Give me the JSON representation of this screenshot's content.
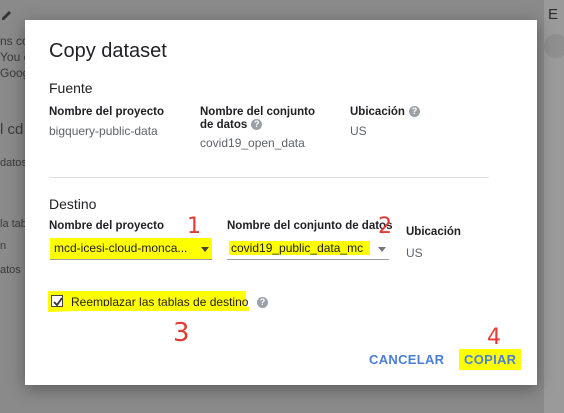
{
  "background": {
    "fragments": [
      "ns co",
      "You c",
      "Goog",
      "l cd",
      "datos",
      "la tab",
      "n",
      "atos"
    ],
    "right_letter": "E"
  },
  "dialog": {
    "title": "Copy dataset",
    "source": {
      "heading": "Fuente",
      "project_label": "Nombre del proyecto",
      "project_value": "bigquery-public-data",
      "dataset_label": "Nombre del conjunto de datos",
      "dataset_value": "covid19_open_data",
      "location_label": "Ubicación",
      "location_value": "US"
    },
    "destination": {
      "heading": "Destino",
      "project_label": "Nombre del proyecto",
      "project_value": "mcd-icesi-cloud-monca...",
      "dataset_label": "Nombre del conjunto de datos",
      "dataset_value": "covid19_public_data_mc",
      "location_label": "Ubicación",
      "location_value": "US"
    },
    "replace_label": "Reemplazar las tablas de destino",
    "replace_checked": true,
    "cancel_label": "CANCELAR",
    "copy_label": "COPIAR"
  },
  "annotations": [
    "1",
    "2",
    "3",
    "4"
  ],
  "colors": {
    "highlight": "#ffff00",
    "button_text": "#4a7fd8",
    "annotation": "#e53935"
  }
}
